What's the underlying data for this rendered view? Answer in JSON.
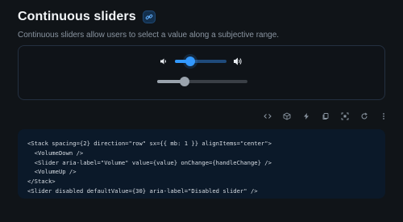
{
  "header": {
    "title": "Continuous sliders",
    "subtitle": "Continuous sliders allow users to select a value along a subjective range."
  },
  "demo": {
    "volume_slider": {
      "value": 30,
      "aria_label": "Volume"
    },
    "disabled_slider": {
      "value": 30,
      "aria_label": "Disabled slider"
    }
  },
  "toolbar": {
    "icons": [
      "code-icon",
      "sandbox-icon",
      "lightning-icon",
      "copy-icon",
      "focus-icon",
      "reset-icon",
      "more-icon"
    ]
  },
  "code": {
    "line1": "<Stack spacing={2} direction=\"row\" sx={{ mb: 1 }} alignItems=\"center\">",
    "line2": "  <VolumeDown />",
    "line3": "  <Slider aria-label=\"Volume\" value={value} onChange={handleChange} />",
    "line4": "  <VolumeUp />",
    "line5": "</Stack>",
    "line6": "<Slider disabled defaultValue={30} aria-label=\"Disabled slider\" />"
  },
  "colors": {
    "accent": "#3399ff",
    "background": "#101418",
    "code_background": "#0b1929"
  }
}
